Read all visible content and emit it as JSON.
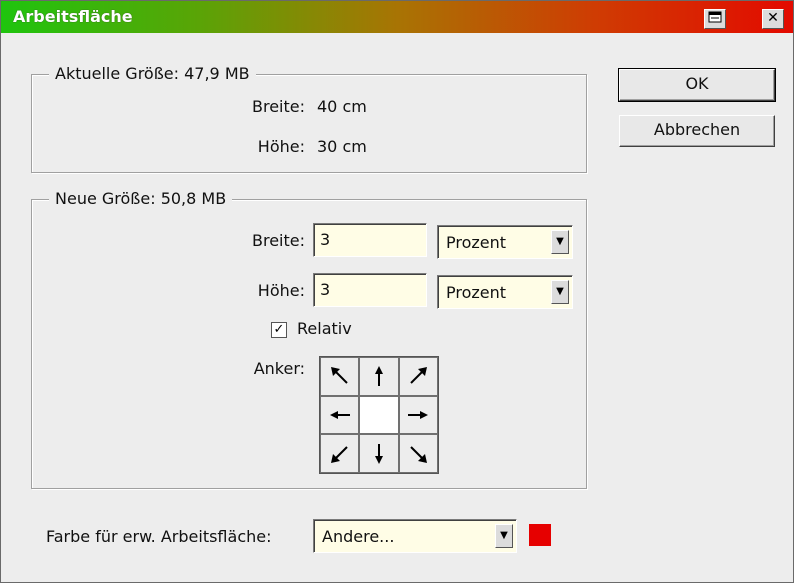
{
  "window": {
    "title": "Arbeitsfläche"
  },
  "titlebar": {
    "help_icon": "help-icon",
    "close_label": "✕"
  },
  "current": {
    "legend": "Aktuelle Größe: 47,9 MB",
    "width_label": "Breite:",
    "width_value": "40 cm",
    "height_label": "Höhe:",
    "height_value": "30 cm"
  },
  "new": {
    "legend": "Neue Größe: 50,8 MB",
    "width_label": "Breite:",
    "width_value": "3",
    "width_unit": "Prozent",
    "height_label": "Höhe:",
    "height_value": "3",
    "height_unit": "Prozent",
    "relative_label": "Relativ",
    "relative_checked": true,
    "anchor_label": "Anker:"
  },
  "extension_color": {
    "label": "Farbe für erw. Arbeitsfläche:",
    "value": "Andere...",
    "swatch_color": "#e60000"
  },
  "buttons": {
    "ok": "OK",
    "cancel": "Abbrechen"
  }
}
